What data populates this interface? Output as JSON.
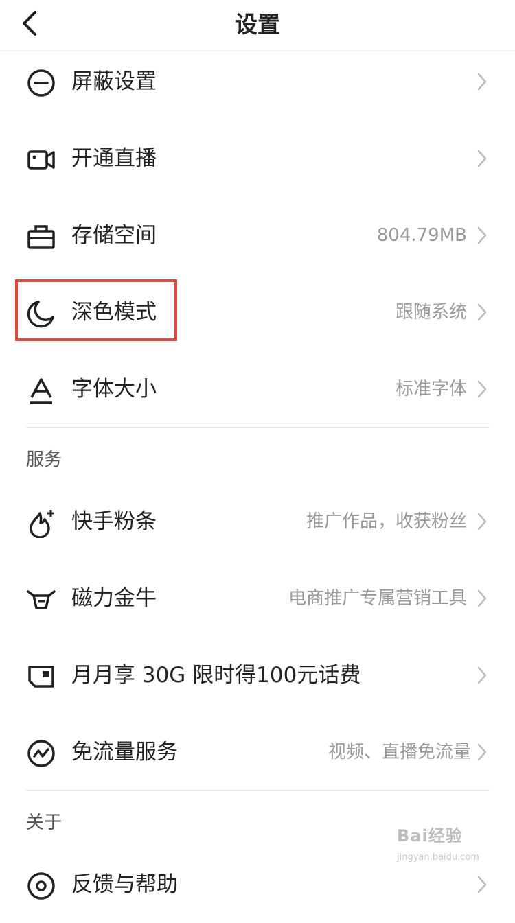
{
  "header": {
    "title": "设置"
  },
  "settings": {
    "items": [
      {
        "icon": "block-icon",
        "label": "屏蔽设置",
        "value": ""
      },
      {
        "icon": "video-camera-icon",
        "label": "开通直播",
        "value": ""
      },
      {
        "icon": "storage-box-icon",
        "label": "存储空间",
        "value": "804.79MB"
      },
      {
        "icon": "moon-icon",
        "label": "深色模式",
        "value": "跟随系统"
      },
      {
        "icon": "font-size-icon",
        "label": "字体大小",
        "value": "标准字体"
      }
    ]
  },
  "services": {
    "title": "服务",
    "items": [
      {
        "icon": "fire-plus-icon",
        "label": "快手粉条",
        "value": "推广作品，收获粉丝"
      },
      {
        "icon": "bull-icon",
        "label": "磁力金牛",
        "value": "电商推广专属营销工具"
      },
      {
        "icon": "sim-card-icon",
        "label": "月月享 30G 限时得100元话费",
        "value": ""
      },
      {
        "icon": "free-data-icon",
        "label": "免流量服务",
        "value": "视频、直播免流量"
      }
    ]
  },
  "about": {
    "title": "关于",
    "items": [
      {
        "icon": "help-icon",
        "label": "反馈与帮助",
        "value": ""
      }
    ]
  },
  "watermark": {
    "brand": "Bai经验",
    "url": "jingyan.baidu.com"
  },
  "colors": {
    "highlight": "#e0483e",
    "value_text": "#9a9a9a",
    "divider": "#e8e8e8"
  }
}
